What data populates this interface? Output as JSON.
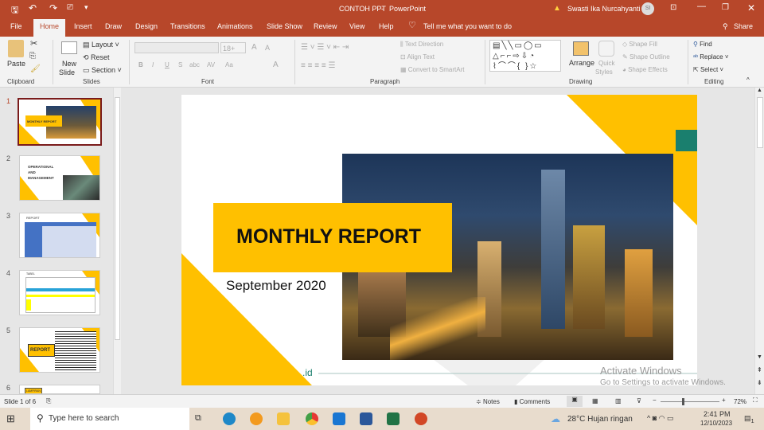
{
  "titlebar": {
    "doc_title": "CONTOH PPT",
    "app": "PowerPoint",
    "separator": "-",
    "user": "Swasti Ika Nurcahyanti",
    "avatar": "SI"
  },
  "tabs": [
    "File",
    "Home",
    "Insert",
    "Draw",
    "Design",
    "Transitions",
    "Animations",
    "Slide Show",
    "Review",
    "View",
    "Help"
  ],
  "tell_me": "Tell me what you want to do",
  "share": "Share",
  "ribbon": {
    "clipboard": {
      "paste": "Paste",
      "label": "Clipboard"
    },
    "slides": {
      "new_slide": "New",
      "new_slide2": "Slide",
      "layout": "Layout",
      "reset": "Reset",
      "section": "Section",
      "label": "Slides"
    },
    "font": {
      "size": "18+",
      "label": "Font",
      "bold": "B",
      "italic": "I",
      "underline": "U",
      "shadow": "S",
      "strike": "abc",
      "spacing": "AV",
      "case": "Aa",
      "grow": "A",
      "shrink": "A",
      "color": "A"
    },
    "paragraph": {
      "text_direction": "Text Direction",
      "align_text": "Align Text",
      "smartart": "Convert to SmartArt",
      "label": "Paragraph"
    },
    "drawing": {
      "arrange": "Arrange",
      "quick": "Quick",
      "styles": "Styles",
      "shape_fill": "Shape Fill",
      "shape_outline": "Shape Outline",
      "shape_effects": "Shape Effects",
      "label": "Drawing"
    },
    "editing": {
      "find": "Find",
      "replace": "Replace",
      "select": "Select",
      "label": "Editing"
    }
  },
  "thumbnails": [
    {
      "num": "1",
      "title": "MONTHLY REPORT"
    },
    {
      "num": "2",
      "title": "OPERATIONAL AND MANAGEMENT"
    },
    {
      "num": "3",
      "title": "REPORT"
    },
    {
      "num": "4",
      "title": "TABEL"
    },
    {
      "num": "5",
      "title": "REPORT"
    },
    {
      "num": "6",
      "title": "LAMPIRAN"
    }
  ],
  "slide": {
    "title": "MONTHLY REPORT",
    "subtitle": "September 2020",
    "footer": ".id"
  },
  "watermark": {
    "line1": "Activate Windows",
    "line2": "Go to Settings to activate Windows."
  },
  "status": {
    "slide_info": "Slide 1 of 6",
    "notes": "Notes",
    "comments": "Comments",
    "zoom": "72%"
  },
  "taskbar": {
    "search": "Type here to search",
    "weather": "28°C  Hujan ringan",
    "time": "2:41 PM",
    "date": "12/10/2023",
    "notif": "1"
  },
  "colors": {
    "accent": "#b7472a",
    "yellow": "#ffc000",
    "green": "#1a7f6e"
  }
}
